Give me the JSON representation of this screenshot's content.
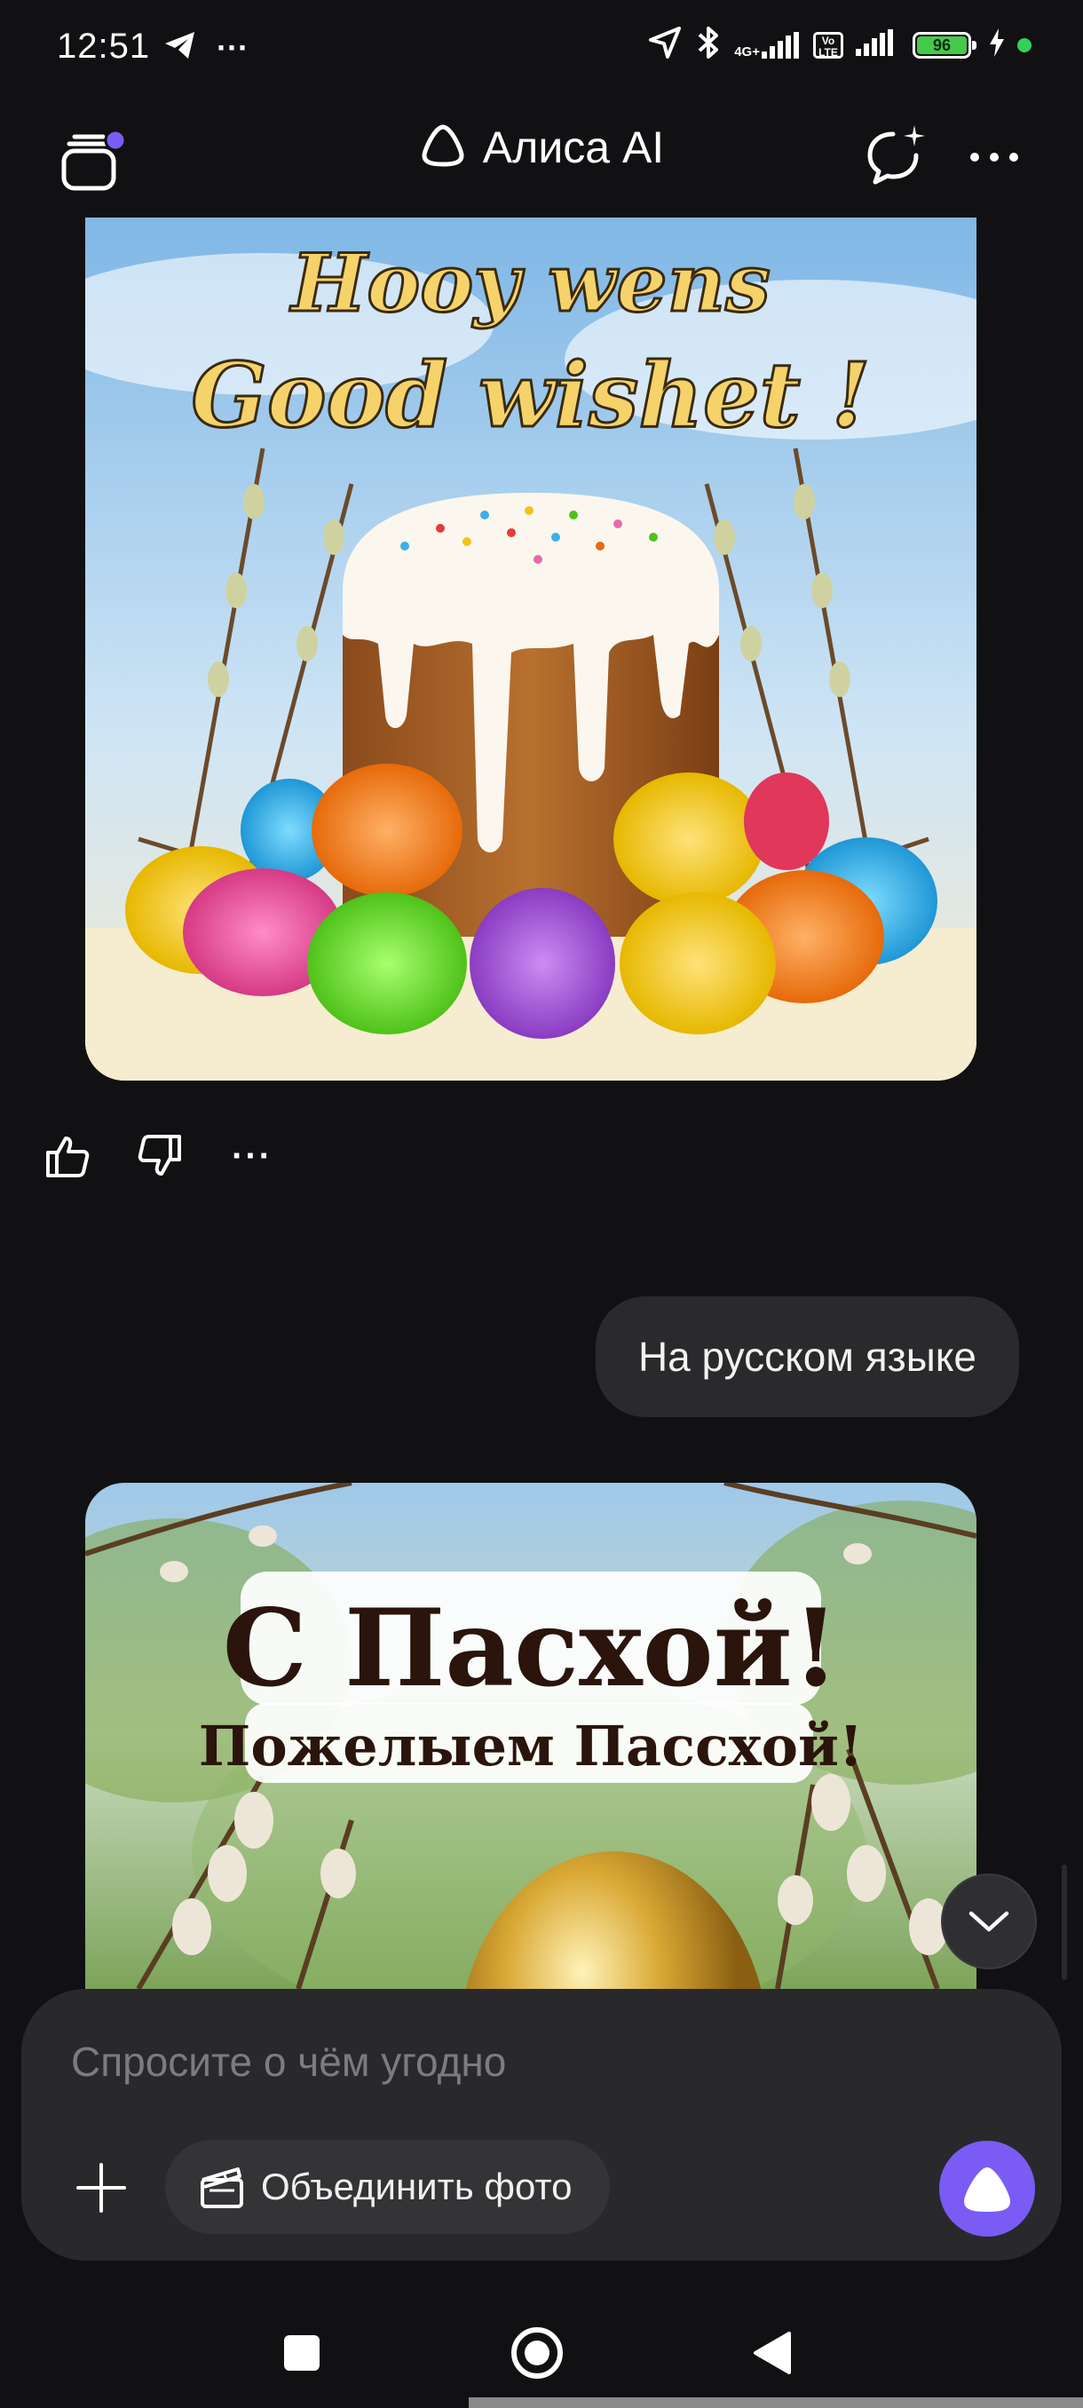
{
  "status_bar": {
    "time": "12:51",
    "more": "···",
    "network_label_top": "4G+",
    "network_label_bottom": "",
    "volte_label": "Vo LTE",
    "battery_level": "96",
    "icons": [
      "telegram-icon",
      "location-icon",
      "bluetooth-icon",
      "signal-icon",
      "battery-icon",
      "charging-icon"
    ]
  },
  "header": {
    "title": "Алиса AI",
    "icons": [
      "chats-menu-icon",
      "alice-logo-icon",
      "new-chat-icon",
      "more-icon"
    ],
    "accent_dot_color": "#7a5cf5"
  },
  "chat": {
    "image_1": {
      "line_1": "Hooy wens",
      "line_2": "Good wishet !"
    },
    "feedback": {
      "like": "thumbs-up-icon",
      "dislike": "thumbs-down-icon",
      "more": "···"
    },
    "user_message": "На русском языке",
    "image_2": {
      "line_1": "С Пасхой!",
      "line_2": "Пожелыем Пассхой!"
    }
  },
  "composer": {
    "placeholder": "Спросите о чём угодно",
    "merge_label": "Объединить фото",
    "accent_color": "#7a5cf5"
  },
  "nav": {
    "icons": [
      "recents-icon",
      "home-icon",
      "back-icon"
    ]
  }
}
